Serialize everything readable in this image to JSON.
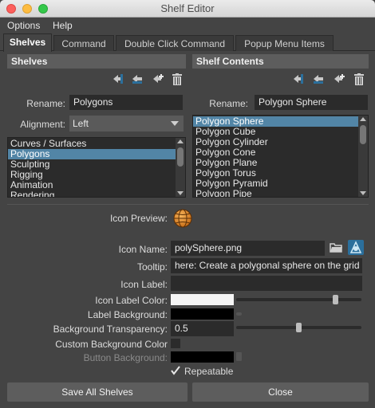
{
  "window": {
    "title": "Shelf Editor"
  },
  "menu": {
    "options": "Options",
    "help": "Help"
  },
  "tabs": [
    {
      "label": "Shelves",
      "active": true
    },
    {
      "label": "Command",
      "active": false
    },
    {
      "label": "Double Click Command",
      "active": false
    },
    {
      "label": "Popup Menu Items",
      "active": false
    }
  ],
  "shelves": {
    "header": "Shelves",
    "rename_label": "Rename:",
    "rename_value": "Polygons",
    "alignment_label": "Alignment:",
    "alignment_value": "Left",
    "items": [
      "Curves / Surfaces",
      "Polygons",
      "Sculpting",
      "Rigging",
      "Animation",
      "Rendering"
    ],
    "selected_index": 1
  },
  "contents": {
    "header": "Shelf Contents",
    "rename_label": "Rename:",
    "rename_value": "Polygon Sphere",
    "items": [
      "Polygon Sphere",
      "Polygon Cube",
      "Polygon Cylinder",
      "Polygon Cone",
      "Polygon Plane",
      "Polygon Torus",
      "Polygon Pyramid",
      "Polygon Pipe"
    ],
    "selected_index": 0
  },
  "properties": {
    "icon_preview_label": "Icon Preview:",
    "icon_name_label": "Icon Name:",
    "icon_name_value": "polySphere.png",
    "tooltip_label": "Tooltip:",
    "tooltip_value": "here: Create a polygonal sphere on the grid",
    "icon_label_label": "Icon Label:",
    "icon_label_value": "",
    "icon_label_color_label": "Icon Label Color:",
    "icon_label_color": "#f5f5f5",
    "icon_label_color_slider": 0.8,
    "label_background_label": "Label Background:",
    "label_background_color": "#000000",
    "background_transparency_label": "Background Transparency:",
    "background_transparency_value": "0.5",
    "background_transparency_slider": 0.5,
    "custom_background_label": "Custom Background Color",
    "custom_background_checked": false,
    "button_background_label": "Button Background:",
    "button_background_color": "#000000",
    "repeatable_label": "Repeatable",
    "repeatable_checked": true
  },
  "buttons": {
    "save": "Save All Shelves",
    "close": "Close"
  },
  "colors": {
    "accent": "#5285a6",
    "panel": "#444444",
    "field": "#2b2b2b",
    "header": "#5d5d5d"
  },
  "icons": [
    "move-up-icon",
    "move-down-icon",
    "new-shelf-icon",
    "trash-icon",
    "folder-icon",
    "sphere-icon"
  ]
}
